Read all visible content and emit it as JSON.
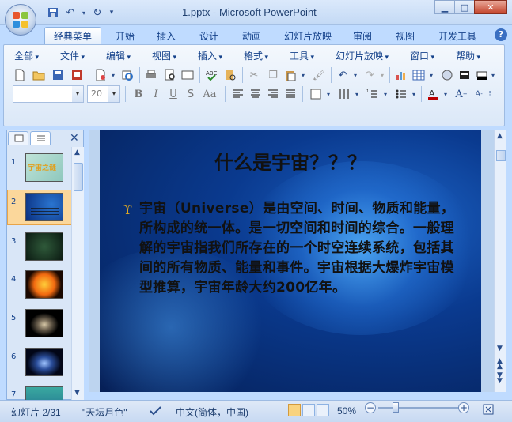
{
  "window": {
    "title": "1.pptx - Microsoft PowerPoint",
    "minimize": "▁",
    "maximize": "□",
    "close": "✕"
  },
  "ribbon_tabs": [
    {
      "label": "经典菜单",
      "active": true
    },
    {
      "label": "开始"
    },
    {
      "label": "插入"
    },
    {
      "label": "设计"
    },
    {
      "label": "动画"
    },
    {
      "label": "幻灯片放映"
    },
    {
      "label": "审阅"
    },
    {
      "label": "视图"
    },
    {
      "label": "开发工具"
    }
  ],
  "classic_menus": [
    "全部",
    "文件",
    "编辑",
    "视图",
    "插入",
    "格式",
    "工具",
    "幻灯片放映",
    "窗口",
    "帮助"
  ],
  "format_bar": {
    "font_name": "",
    "font_size": "20",
    "bold": "B",
    "italic": "I",
    "underline": "U",
    "strike": "S",
    "change_case": "Aa"
  },
  "slides_panel": {
    "thumbnails": [
      {
        "number": "1",
        "caption": "宇宙之谜"
      },
      {
        "number": "2",
        "selected": true
      },
      {
        "number": "3"
      },
      {
        "number": "4"
      },
      {
        "number": "5"
      },
      {
        "number": "6"
      },
      {
        "number": "7"
      }
    ]
  },
  "slide": {
    "title": "什么是宇宙？？？",
    "bullet_symbol": "ϒ",
    "body": "宇宙（Universe）是由空间、时间、物质和能量，所构成的统一体。是一切空间和时间的综合。一般理解的宇宙指我们所存在的一个时空连续系统，包括其间的所有物质、能量和事件。宇宙根据大爆炸宇宙模型推算，宇宙年龄大约200亿年。"
  },
  "status": {
    "slide_counter": "幻灯片 2/31",
    "theme": "\"天坛月色\"",
    "language": "中文(简体，中国)",
    "zoom": "50%"
  },
  "colors": {
    "accent": "#15428b",
    "selection": "#f7b34a"
  }
}
